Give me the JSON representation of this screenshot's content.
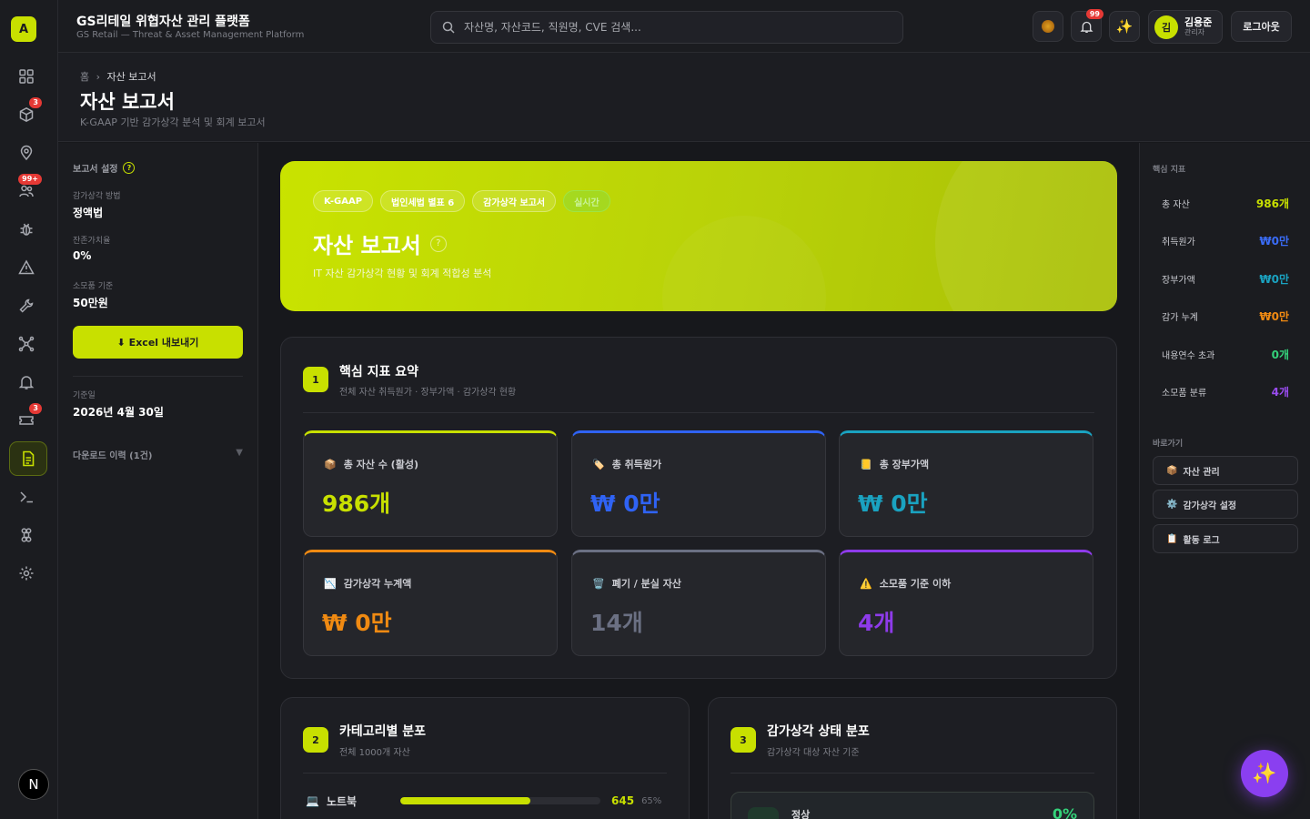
{
  "app": {
    "logo_letter": "A",
    "title": "GS리테일 위협자산 관리 플랫폼",
    "subtitle": "GS Retail — Threat & Asset Management Platform"
  },
  "rail": {
    "items": [
      {
        "icon": "dashboard-icon",
        "badge": ""
      },
      {
        "icon": "cube-icon",
        "badge": "3"
      },
      {
        "icon": "location-pin-icon",
        "badge": ""
      },
      {
        "icon": "people-icon",
        "badge": "99+"
      },
      {
        "icon": "bug-icon",
        "badge": ""
      },
      {
        "icon": "warning-triangle-icon",
        "badge": ""
      },
      {
        "icon": "wrench-icon",
        "badge": ""
      },
      {
        "icon": "network-icon",
        "badge": ""
      },
      {
        "icon": "bell-icon",
        "badge": ""
      },
      {
        "icon": "ticket-icon",
        "badge": "3"
      },
      {
        "icon": "report-document-icon",
        "badge": "",
        "active": true
      },
      {
        "icon": "terminal-icon",
        "badge": ""
      },
      {
        "icon": "command-icon",
        "badge": ""
      },
      {
        "icon": "settings-gear-icon",
        "badge": ""
      }
    ],
    "bottom_button": "N"
  },
  "search": {
    "placeholder": "자산명, 자산코드, 직원명, CVE 검색..."
  },
  "topbar": {
    "notification_badge": "99",
    "user_initial": "김",
    "user_name": "김용준",
    "user_role": "관리자",
    "logout_label": "로그아웃"
  },
  "page": {
    "breadcrumb_home": "홈",
    "breadcrumb_sep": "›",
    "breadcrumb_current": "자산 보고서",
    "title": "자산 보고서",
    "subtitle": "K-GAAP 기반 감가상각 분석 및 회계 보고서"
  },
  "settings": {
    "header": "보고서 설정",
    "help": "?",
    "method_label": "감가상각 방법",
    "method_value": "정액법",
    "residual_label": "잔존가치율",
    "residual_value": "0%",
    "consumable_label": "소모품 기준",
    "consumable_value": "50만원",
    "excel_label": "⬇ Excel 내보내기",
    "base_date_label": "기준일",
    "base_date_value": "2026년 4월 30일",
    "download_history": "다운로드 이력 (1건)",
    "download_caret": "▼"
  },
  "hero": {
    "chips": [
      "K-GAAP",
      "법인세법 별표 6",
      "감가상각 보고서"
    ],
    "live_chip": "실시간",
    "title": "자산 보고서",
    "help": "?",
    "subtitle": "IT 자산 감가상각 현황 및 회계 적합성 분석"
  },
  "section1": {
    "number": "1",
    "title": "핵심 지표 요약",
    "subtitle": "전체 자산 취득원가 · 장부가액 · 감가상각 현황",
    "cards": [
      {
        "icon": "📦",
        "label": "총 자산 수 (활성)",
        "value": "986개",
        "color": "#c8e000"
      },
      {
        "icon": "🏷️",
        "label": "총 취득원가",
        "value": "₩ 0만",
        "color": "#2f63f5"
      },
      {
        "icon": "📒",
        "label": "총 장부가액",
        "value": "₩ 0만",
        "color": "#1aa2c0"
      },
      {
        "icon": "📉",
        "label": "감가상각 누계액",
        "value": "₩ 0만",
        "color": "#f08a12"
      },
      {
        "icon": "🗑️",
        "label": "폐기 / 분실 자산",
        "value": "14개",
        "color": "#6b7083"
      },
      {
        "icon": "⚠️",
        "label": "소모품 기준 이하",
        "value": "4개",
        "color": "#8e3bea"
      }
    ]
  },
  "section2": {
    "number": "2",
    "title": "카테고리별 분포",
    "subtitle": "전체 1000개 자산",
    "bars": [
      {
        "icon": "💻",
        "label": "노트북",
        "count": "645",
        "pct": "65%",
        "fraction": 0.65
      }
    ]
  },
  "section3": {
    "number": "3",
    "title": "감가상각 상태 분포",
    "subtitle": "감가상각 대상 자산 기준",
    "rows": [
      {
        "label": "정상",
        "pct": "0%"
      }
    ]
  },
  "right": {
    "kpi_header": "핵심 지표",
    "kpis": [
      {
        "label": "총 자산",
        "value": "986개",
        "color": "#c8e000"
      },
      {
        "label": "취득원가",
        "value": "₩0만",
        "color": "#3a6cf7"
      },
      {
        "label": "장부가액",
        "value": "₩0만",
        "color": "#1aa2c0"
      },
      {
        "label": "감가 누계",
        "value": "₩0만",
        "color": "#f08a12"
      },
      {
        "label": "내용연수 초과",
        "value": "0개",
        "color": "#34d27a"
      },
      {
        "label": "소모품 분류",
        "value": "4개",
        "color": "#9a4cf0"
      }
    ],
    "shortcuts_header": "바로가기",
    "shortcuts": [
      {
        "icon": "📦",
        "label": "자산 관리"
      },
      {
        "icon": "⚙️",
        "label": "감가상각 설정"
      },
      {
        "icon": "📋",
        "label": "활동 로그"
      }
    ]
  },
  "fab": {
    "icon": "✨"
  }
}
